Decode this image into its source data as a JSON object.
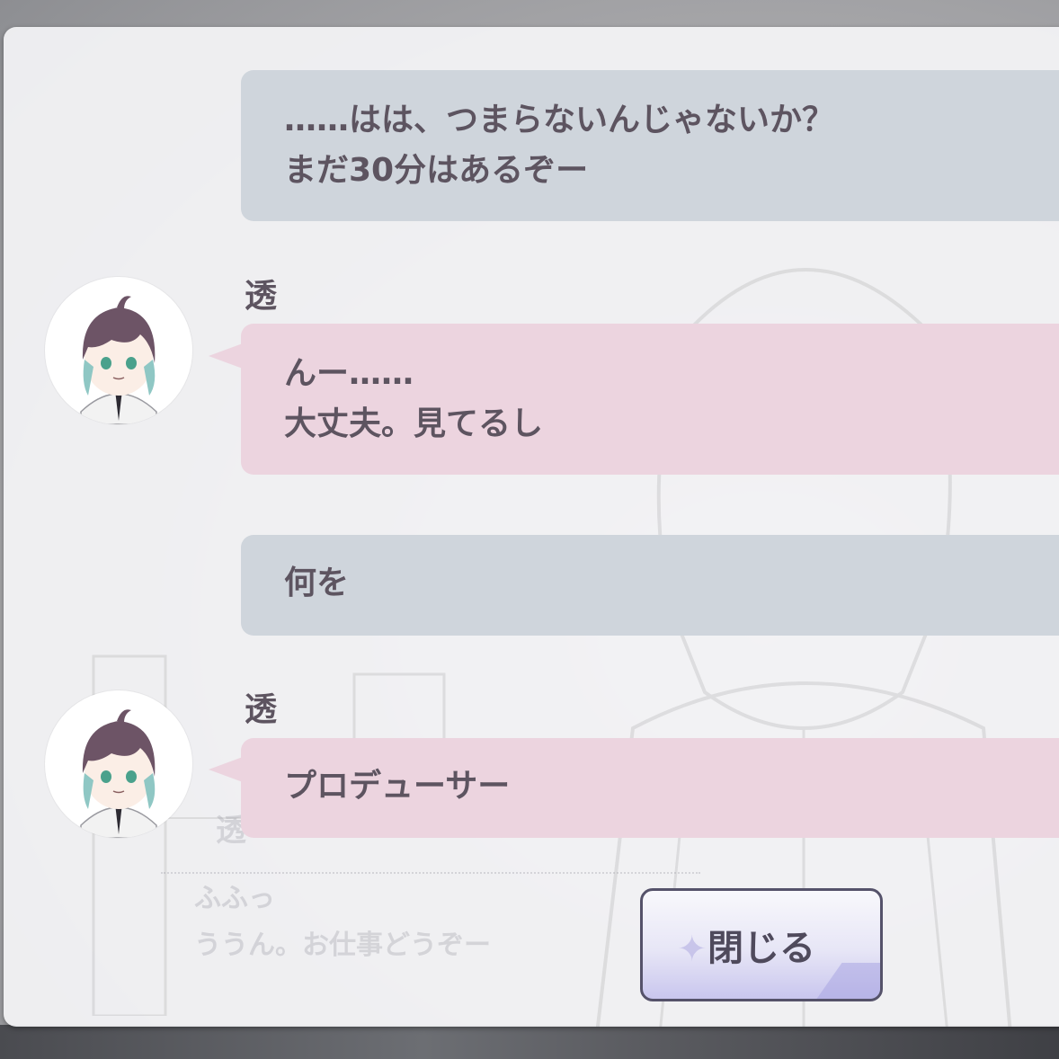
{
  "dialogue_log": [
    {
      "speaker": "producer",
      "lines": [
        "……はは、つまらないんじゃないか？",
        "まだ30分はあるぞー"
      ]
    },
    {
      "speaker": "idol",
      "name": "透",
      "lines": [
        "んー……",
        "大丈夫。見てるし"
      ]
    },
    {
      "speaker": "producer",
      "lines": [
        "何を"
      ]
    },
    {
      "speaker": "idol",
      "name": "透",
      "lines": [
        "プロデューサー"
      ]
    }
  ],
  "background_dialogue": {
    "name": "透",
    "lines": [
      "ふふっ",
      "ううん。お仕事どうぞー"
    ]
  },
  "close_button": {
    "label": "閉じる"
  },
  "colors": {
    "producer_bubble": "#cfd5dc",
    "idol_bubble": "#ecd4df",
    "text": "#5d5460",
    "panel": "#f4f4f6"
  }
}
